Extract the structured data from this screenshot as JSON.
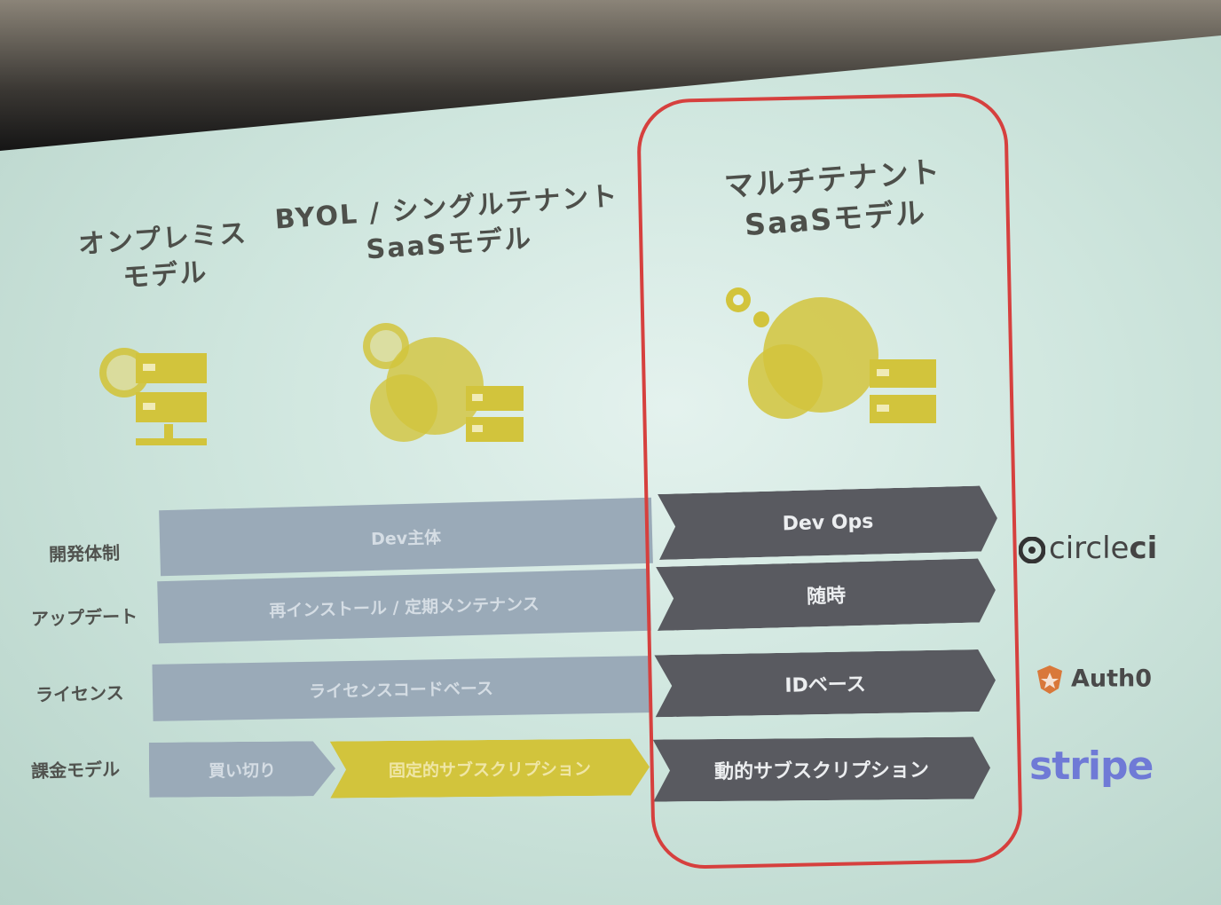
{
  "models": {
    "onprem": "オンプレミス\nモデル",
    "byol": "BYOL / シングルテナント\nSaaSモデル",
    "multi": "マルチテナント\nSaaSモデル"
  },
  "rows": {
    "dev": {
      "label": "開発体制",
      "left": "Dev主体",
      "right": "Dev Ops"
    },
    "update": {
      "label": "アップデート",
      "left": "再インストール / 定期メンテナンス",
      "right": "随時"
    },
    "license": {
      "label": "ライセンス",
      "left": "ライセンスコードベース",
      "right": "IDベース"
    },
    "billing": {
      "label": "課金モデル",
      "left1": "買い切り",
      "left2": "固定的サブスクリプション",
      "right": "動的サブスクリプション"
    }
  },
  "logos": {
    "circleci_a": "circle",
    "circleci_b": "ci",
    "auth0": "Auth0",
    "stripe": "stripe"
  },
  "colors": {
    "accent_yellow": "#d2c43c",
    "bar_blue": "#9aaab8",
    "bar_dark": "#595a60",
    "highlight_red": "#d6403e",
    "stripe_purple": "#6f7ad6"
  }
}
